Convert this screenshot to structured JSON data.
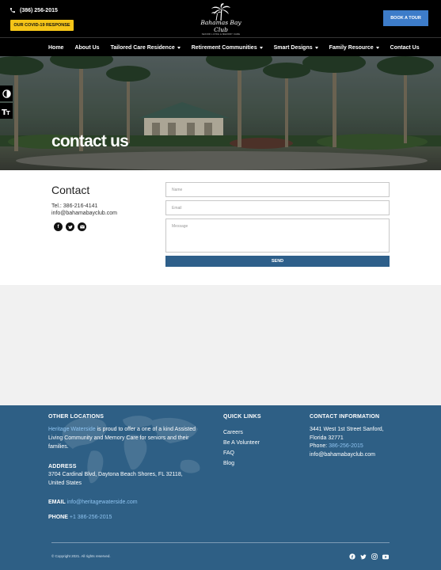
{
  "topbar": {
    "phone": "(386) 256-2015",
    "covid_button": "OUR COVID-19 RESPONSE",
    "logo_text": "Bahamas Bay Club",
    "logo_sub": "SENIOR LIVING & MEMORY CARE",
    "tour_button": "BOOK A TOUR"
  },
  "nav": {
    "items": [
      {
        "label": "Home",
        "dropdown": false
      },
      {
        "label": "About Us",
        "dropdown": false
      },
      {
        "label": "Tailored Care Residence",
        "dropdown": true
      },
      {
        "label": "Retirement Communities",
        "dropdown": true
      },
      {
        "label": "Smart Designs",
        "dropdown": true
      },
      {
        "label": "Family Resource",
        "dropdown": true
      },
      {
        "label": "Contact Us",
        "dropdown": false
      }
    ]
  },
  "hero": {
    "title": "contact us"
  },
  "accessibility": {
    "contrast_icon": "contrast-icon",
    "font_size_icon": "font-size-icon"
  },
  "contact": {
    "heading": "Contact",
    "tel": "Tel.: 386-216-4141",
    "email": "info@bahamabayclub.com",
    "socials": [
      "facebook-icon",
      "twitter-icon",
      "email-icon"
    ],
    "form": {
      "name_placeholder": "Name",
      "email_placeholder": "Email",
      "message_placeholder": "Message",
      "send_label": "SEND"
    }
  },
  "footer": {
    "other_locations": {
      "heading": "OTHER LOCATIONS",
      "link": "Heritage Waterside",
      "text": " is proud to offer a one of a kind Assisted Living Community and Memory Care for seniors and their families.",
      "address_heading": "ADDRESS",
      "address": "3704 Cardinal Blvd, Daytona Beach Shores, FL 32118, United States",
      "email_label": "EMAIL",
      "email": "info@heritagewaterside.com",
      "phone_label": "PHONE",
      "phone": "+1 386-256-2015"
    },
    "quick_links": {
      "heading": "QUICK LINKS",
      "items": [
        "Careers",
        "Be A Volunteer",
        "FAQ",
        "Blog"
      ]
    },
    "contact_info": {
      "heading": "CONTACT INFORMATION",
      "address_line1": "3441 West 1st Street Sanford,",
      "address_line2": "Florida 32771",
      "phone_label": "Phone:",
      "phone": "386-256-2015",
      "email": "info@bahamabayclub.com"
    },
    "copyright": "© Copyright 2021. All rights reserved.",
    "socials": [
      "facebook-icon",
      "twitter-icon",
      "instagram-icon",
      "youtube-icon"
    ]
  },
  "colors": {
    "accent_yellow": "#f5c518",
    "tour_blue": "#3d7cc9",
    "footer_blue": "#2e5f85",
    "link_blue": "#8ec3f0"
  }
}
